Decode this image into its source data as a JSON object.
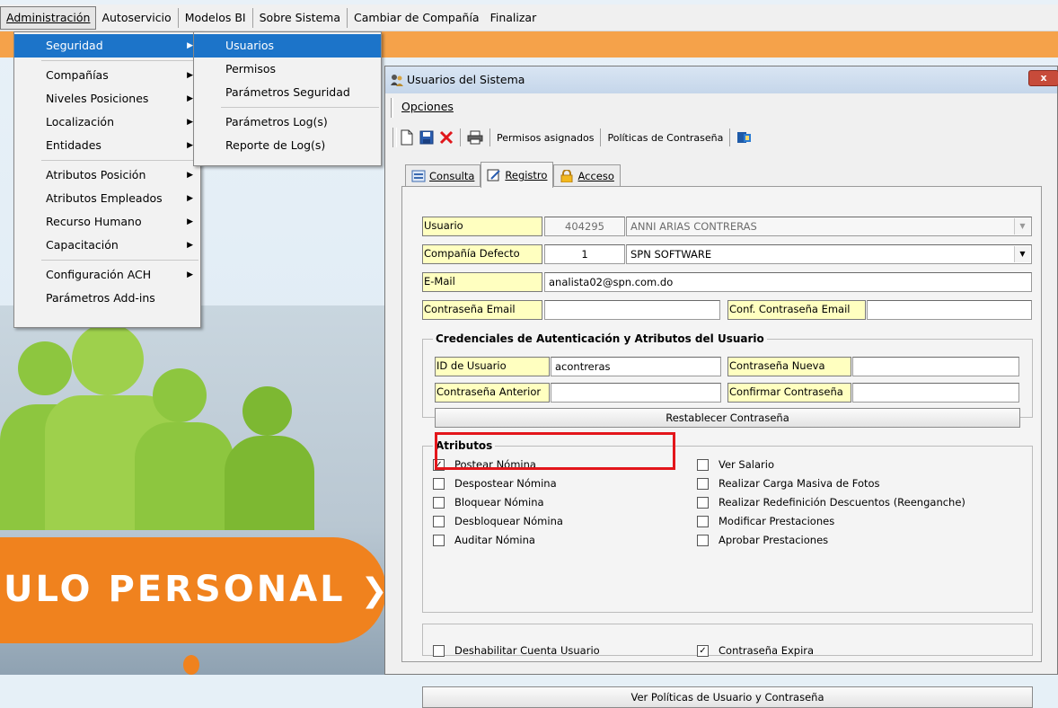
{
  "menubar": {
    "items": [
      "Administración",
      "Autoservicio",
      "Modelos BI",
      "Sobre Sistema",
      "Cambiar de Compañía",
      "Finalizar"
    ]
  },
  "admin_menu": {
    "items": [
      "Seguridad",
      "Compañías",
      "Niveles Posiciones",
      "Localización",
      "Entidades",
      "Atributos Posición",
      "Atributos Empleados",
      "Recurso Humano",
      "Capacitación",
      "Configuración ACH",
      "Parámetros Add-ins"
    ]
  },
  "security_menu": {
    "items": [
      "Usuarios",
      "Permisos",
      "Parámetros Seguridad",
      "Parámetros Log(s)",
      "Reporte de Log(s)"
    ]
  },
  "background": {
    "banner_text": "ULO PERSONAL"
  },
  "dialog": {
    "title": "Usuarios del Sistema",
    "close": "x",
    "menu_opciones": "Opciones",
    "toolbar": {
      "permisos_asignados": "Permisos asignados",
      "politicas": "Políticas de Contraseña"
    },
    "tabs": [
      "Consulta",
      "Registro",
      "Acceso"
    ],
    "form": {
      "usuario_label": "Usuario",
      "usuario_code": "404295",
      "usuario_name": "ANNI ARIAS CONTRERAS",
      "compania_label": "Compañía Defecto",
      "compania_code": "1",
      "compania_name": "SPN SOFTWARE",
      "email_label": "E-Mail",
      "email_value": "analista02@spn.com.do",
      "contrasena_email_label": "Contraseña Email",
      "conf_contrasena_email_label": "Conf. Contraseña Email"
    },
    "credenciales": {
      "title": "Credenciales de Autenticación y Atributos del Usuario",
      "id_usuario_label": "ID de Usuario",
      "id_usuario_value": "acontreras",
      "contrasena_nueva_label": "Contraseña Nueva",
      "contrasena_anterior_label": "Contraseña Anterior",
      "confirmar_contrasena_label": "Confirmar Contraseña",
      "restablecer": "Restablecer Contraseña"
    },
    "atributos": {
      "title": "Atributos",
      "left": [
        {
          "label": "Postear Nómina",
          "checked": true
        },
        {
          "label": "Despostear Nómina",
          "checked": false
        },
        {
          "label": "Bloquear Nómina",
          "checked": false
        },
        {
          "label": "Desbloquear Nómina",
          "checked": false
        },
        {
          "label": "Auditar Nómina",
          "checked": false
        }
      ],
      "right": [
        {
          "label": "Ver Salario",
          "checked": false
        },
        {
          "label": "Realizar Carga Masiva de Fotos",
          "checked": false
        },
        {
          "label": "Realizar Redefinición Descuentos (Reenganche)",
          "checked": false
        },
        {
          "label": "Modificar Prestaciones",
          "checked": false
        },
        {
          "label": "Aprobar Prestaciones",
          "checked": false
        }
      ]
    },
    "cuenta": {
      "deshabilitar": {
        "label": "Deshabilitar Cuenta Usuario",
        "checked": false
      },
      "expira": {
        "label": "Contraseña Expira",
        "checked": true
      }
    },
    "ver_politicas": "Ver Políticas de Usuario y Contraseña"
  },
  "colors": {
    "menu_highlight": "#1c74c9",
    "orange": "#f0821e",
    "green": "#8dc63f",
    "red_highlight": "#e3161b"
  }
}
